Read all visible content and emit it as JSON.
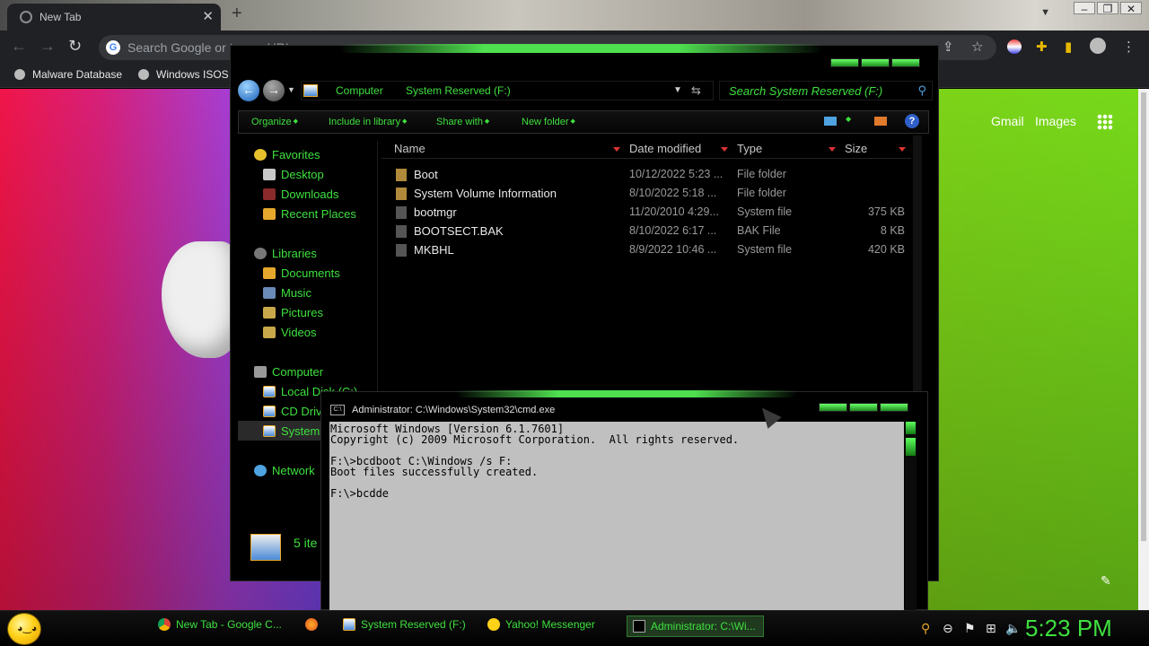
{
  "browser": {
    "tab_title": "New Tab",
    "omnibox_placeholder": "Search Google or type a URL",
    "bookmarks": [
      "Malware Database",
      "Windows ISOS"
    ],
    "page_links": {
      "gmail": "Gmail",
      "images": "Images"
    }
  },
  "explorer": {
    "breadcrumb": [
      "Computer",
      "System Reserved (F:)"
    ],
    "search_placeholder": "Search System Reserved (F:)",
    "commands": [
      "Organize",
      "Include in library",
      "Share with",
      "New folder"
    ],
    "nav": {
      "favorites": {
        "label": "Favorites",
        "items": [
          "Desktop",
          "Downloads",
          "Recent Places"
        ]
      },
      "libraries": {
        "label": "Libraries",
        "items": [
          "Documents",
          "Music",
          "Pictures",
          "Videos"
        ]
      },
      "computer": {
        "label": "Computer",
        "items": [
          "Local Disk (C:)",
          "CD Drive",
          "System"
        ]
      },
      "network": "Network"
    },
    "columns": [
      "Name",
      "Date modified",
      "Type",
      "Size"
    ],
    "files": [
      {
        "name": "Boot",
        "date": "10/12/2022 5:23 ...",
        "type": "File folder",
        "size": ""
      },
      {
        "name": "System Volume Information",
        "date": "8/10/2022 5:18 ...",
        "type": "File folder",
        "size": ""
      },
      {
        "name": "bootmgr",
        "date": "11/20/2010 4:29...",
        "type": "System file",
        "size": "375 KB"
      },
      {
        "name": "BOOTSECT.BAK",
        "date": "8/10/2022 6:17 ...",
        "type": "BAK File",
        "size": "8 KB"
      },
      {
        "name": "MKBHL",
        "date": "8/9/2022 10:46 ...",
        "type": "System file",
        "size": "420 KB"
      }
    ],
    "details": "5 ite"
  },
  "cmd": {
    "title": "Administrator: C:\\Windows\\System32\\cmd.exe",
    "lines": [
      "Microsoft Windows [Version 6.1.7601]",
      "Copyright (c) 2009 Microsoft Corporation.  All rights reserved.",
      "",
      "F:\\>bcdboot C:\\Windows /s F:",
      "Boot files successfully created.",
      "",
      "F:\\>bcdde"
    ]
  },
  "taskbar": {
    "tasks": [
      "New Tab - Google C...",
      "System Reserved (F:)",
      "Yahoo! Messenger",
      "Administrator: C:\\Wi..."
    ],
    "clock": "5:23 PM"
  },
  "colors": {
    "accent": "#3ee03e",
    "explorer_bg": "#000000",
    "cmd_bg": "#c0c0c0"
  }
}
